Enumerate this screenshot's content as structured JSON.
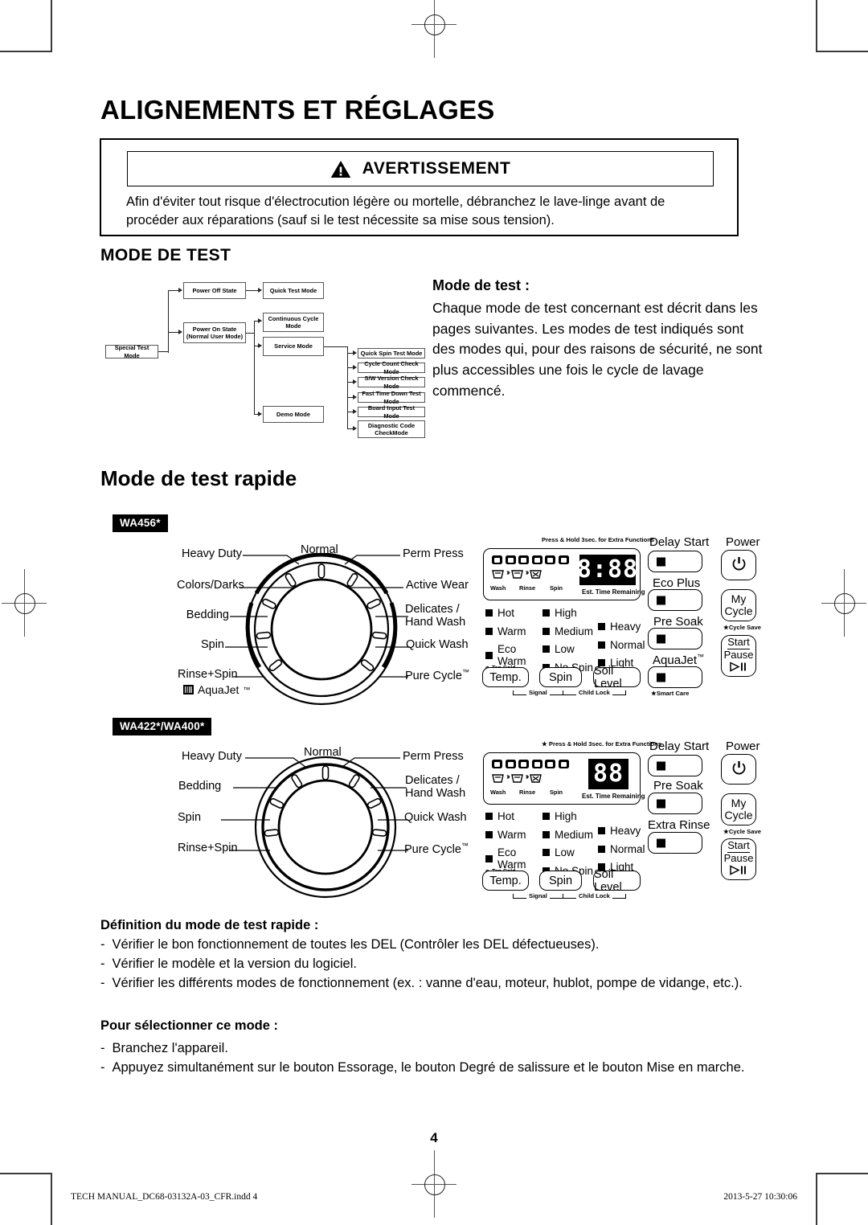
{
  "page": {
    "title": "ALIGNEMENTS ET RÉGLAGES",
    "number": "4"
  },
  "warning": {
    "icon": "warning-triangle-icon",
    "label": "AVERTISSEMENT",
    "body": "Afin d'éviter tout risque d'électrocution légère ou mortelle, débranchez le lave-linge avant de procéder aux réparations (sauf si le test nécessite sa mise sous tension)."
  },
  "section_test_mode": {
    "heading": "MODE DE TEST",
    "note_title": "Mode de test :",
    "note_body": "Chaque mode de test concernant est décrit dans les pages suivantes.  Les modes de test indiqués sont des modes qui, pour des raisons de sécurité, ne sont plus accessibles une fois le cycle de lavage commencé."
  },
  "flowchart": {
    "root": "Special Test Mode",
    "level1": [
      "Power Off State",
      "Power On State\n(Normal User Mode)"
    ],
    "power_off_children": [
      "Quick Test Mode"
    ],
    "power_on_children": [
      "Continuous Cycle\nMode",
      "Service Mode",
      "Demo Mode"
    ],
    "service_children": [
      "Quick Spin Test Mode",
      "Cycle Count Check Mode",
      "S/W Version Check Mode",
      "Fast Time Down Test Mode",
      "Board Input Test Mode",
      "Diagnostic Code\nCheckMode"
    ]
  },
  "section_quick_test": {
    "heading": "Mode de test rapide"
  },
  "panels": [
    {
      "model_tag": "WA456*",
      "dial_labels_left": [
        "Heavy Duty",
        "Colors/Darks",
        "Bedding",
        "Spin",
        "Rinse+Spin"
      ],
      "dial_label_top": "Normal",
      "dial_labels_right": [
        "Perm Press",
        "Active Wear",
        "Delicates /\nHand Wash",
        "Quick Wash",
        "Pure Cycle"
      ],
      "aquajet_tag": "AquaJet",
      "hint": "Press & Hold 3sec. for Extra Functions",
      "progress_labels": [
        "Wash",
        "Rinse",
        "Spin"
      ],
      "display_value": "8:88",
      "display_caption": "Est. Time Remaining",
      "led_temp": [
        "Hot",
        "Warm",
        "Eco Warm",
        "Cold"
      ],
      "led_temp_sub": "Tap Cold",
      "led_spin": [
        "High",
        "Medium",
        "Low",
        "No Spin"
      ],
      "led_soil": [
        "Heavy",
        "Normal",
        "Light"
      ],
      "option_buttons": [
        "Temp.",
        "Spin",
        "Soil Level"
      ],
      "braces": [
        "Signal",
        "Child Lock"
      ],
      "function_buttons": [
        {
          "label": "Delay Start",
          "note": ""
        },
        {
          "label": "Eco Plus",
          "note": ""
        },
        {
          "label": "Pre Soak",
          "note": ""
        },
        {
          "label": "AquaJet",
          "note": "Smart Care"
        }
      ],
      "right_buttons": [
        {
          "label": "Power",
          "glyph": "power-icon",
          "note": ""
        },
        {
          "label": "My\nCycle",
          "glyph": "",
          "note": "Cycle Save"
        },
        {
          "label": "Start\nPause",
          "glyph": "play-pause-icon",
          "note": ""
        }
      ]
    },
    {
      "model_tag": "WA422*/WA400*",
      "dial_labels_left": [
        "Heavy Duty",
        "Bedding",
        "Spin",
        "Rinse+Spin"
      ],
      "dial_label_top": "Normal",
      "dial_labels_right": [
        "Perm Press",
        "Delicates /\nHand Wash",
        "Quick Wash",
        "Pure Cycle"
      ],
      "aquajet_tag": "",
      "hint": "Press & Hold 3sec. for Extra Functions",
      "progress_labels": [
        "Wash",
        "Rinse",
        "Spin"
      ],
      "display_value": "88",
      "display_caption": "Est. Time Remaining",
      "led_temp": [
        "Hot",
        "Warm",
        "Eco Warm",
        "Cold"
      ],
      "led_temp_sub": "Tap Cold",
      "led_spin": [
        "High",
        "Medium",
        "Low",
        "No Spin"
      ],
      "led_soil": [
        "Heavy",
        "Normal",
        "Light"
      ],
      "option_buttons": [
        "Temp.",
        "Spin",
        "Soil Level"
      ],
      "braces": [
        "Signal",
        "Child Lock"
      ],
      "function_buttons": [
        {
          "label": "Delay Start",
          "note": ""
        },
        {
          "label": "Pre Soak",
          "note": ""
        },
        {
          "label": "Extra Rinse",
          "note": ""
        }
      ],
      "right_buttons": [
        {
          "label": "Power",
          "glyph": "power-icon",
          "note": ""
        },
        {
          "label": "My\nCycle",
          "glyph": "",
          "note": "Cycle Save"
        },
        {
          "label": "Start\nPause",
          "glyph": "play-pause-icon",
          "note": ""
        }
      ]
    }
  ],
  "definition": {
    "heading": "Définition du mode de test rapide :",
    "items": [
      "Vérifier le bon fonctionnement de toutes les DEL (Contrôler les DEL défectueuses).",
      "Vérifier le modèle et la version du logiciel.",
      "Vérifier les différents modes de fonctionnement (ex. : vanne d'eau, moteur, hublot, pompe de vidange, etc.)."
    ],
    "bullet": "-"
  },
  "selection": {
    "heading": "Pour sélectionner ce mode :",
    "items": [
      "Branchez l'appareil.",
      "Appuyez simultanément sur le bouton Essorage, le bouton Degré de salissure et le bouton Mise en marche."
    ],
    "bullet": "-"
  },
  "footer": {
    "left": "TECH MANUAL_DC68-03132A-03_CFR.indd   4",
    "right": "2013-5-27   10:30:06"
  }
}
